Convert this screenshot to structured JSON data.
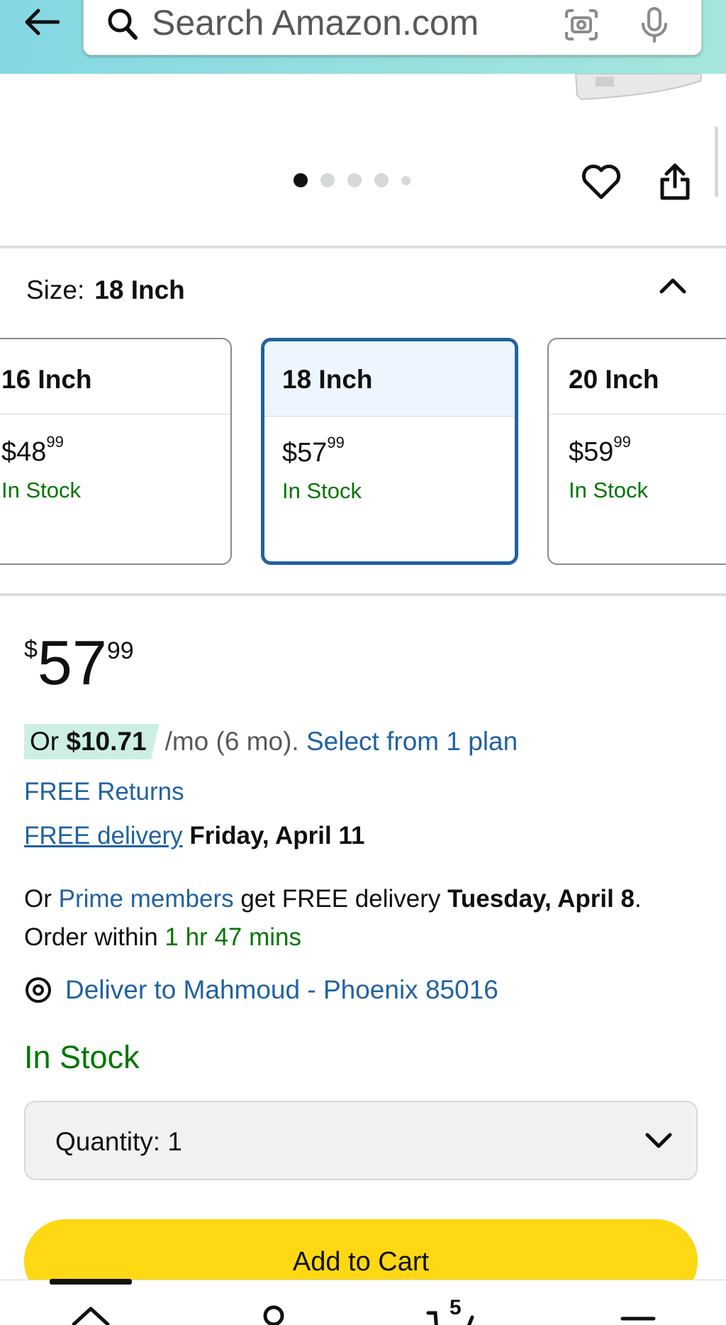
{
  "header": {
    "search_placeholder": "Search Amazon.com",
    "back_icon": "back-arrow-icon",
    "search_icon": "search-icon",
    "camera_icon": "camera-icon",
    "mic_icon": "microphone-icon"
  },
  "carousel": {
    "dot_count": 5,
    "active_index": 0
  },
  "size": {
    "label": "Size:",
    "value": "18 Inch",
    "options": [
      {
        "name": "16 Inch",
        "price_dollars": "$48",
        "price_cents": "99",
        "stock": "In Stock",
        "selected": false
      },
      {
        "name": "18 Inch",
        "price_dollars": "$57",
        "price_cents": "99",
        "stock": "In Stock",
        "selected": true
      },
      {
        "name": "20 Inch",
        "price_dollars": "$59",
        "price_cents": "99",
        "stock": "In Stock",
        "selected": false
      }
    ]
  },
  "price": {
    "currency": "$",
    "dollars": "57",
    "cents": "99"
  },
  "installment": {
    "or": "Or",
    "amount": "$10.71",
    "term": "/mo (6 mo).",
    "link": "Select from 1 plan"
  },
  "returns": "FREE Returns",
  "delivery": {
    "link": "FREE delivery",
    "date": "Friday, April 11"
  },
  "prime": {
    "prefix": "Or",
    "link": "Prime members",
    "middle": "get FREE delivery",
    "date": "Tuesday, April 8",
    "suffix": ". Order within",
    "countdown": "1 hr 47 mins"
  },
  "deliver_to": "Deliver to Mahmoud - Phoenix 85016",
  "stock_status": "In Stock",
  "quantity": {
    "label": "Quantity:",
    "value": "1"
  },
  "add_to_cart": "Add to Cart",
  "bottom_nav": {
    "badge": "5"
  },
  "colors": {
    "link": "#2162a1",
    "stock_green": "#007600",
    "cart_yellow": "#ffd814",
    "selected_border": "#2162a1",
    "header_teal": "#84d8e3"
  }
}
